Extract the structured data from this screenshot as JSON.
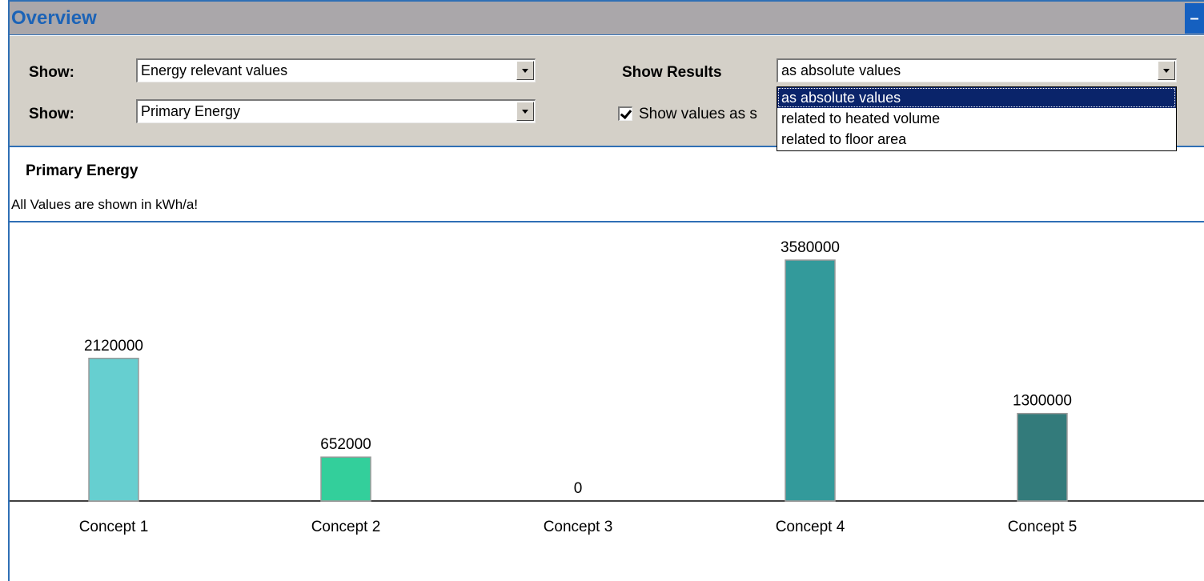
{
  "window": {
    "title": "Overview",
    "collapse_label": "–"
  },
  "controls": {
    "show1": {
      "label": "Show:",
      "value": "Energy relevant values"
    },
    "show2": {
      "label": "Show:",
      "value": "Primary Energy"
    },
    "show_results": {
      "label": "Show Results",
      "value": "as absolute values",
      "options": [
        "as absolute values",
        "related to heated volume",
        "related to floor area"
      ],
      "selected_index": 0
    },
    "checkbox": {
      "label": "Show values as s",
      "checked": true
    }
  },
  "info": {
    "heading": "Primary Energy",
    "units_note": "All Values are shown in kWh/a!"
  },
  "chart_data": {
    "type": "bar",
    "categories": [
      "Concept 1",
      "Concept 2",
      "Concept 3",
      "Concept 4",
      "Concept 5"
    ],
    "values": [
      2120000,
      652000,
      0,
      3580000,
      1300000
    ],
    "value_labels": [
      "2120000",
      "652000",
      "0",
      "3580000",
      "1300000"
    ],
    "colors": [
      "#66cfd0",
      "#33cf9b",
      "#33aaa8",
      "#339a9b",
      "#337b7b"
    ],
    "ylim": [
      0,
      3580000
    ]
  }
}
